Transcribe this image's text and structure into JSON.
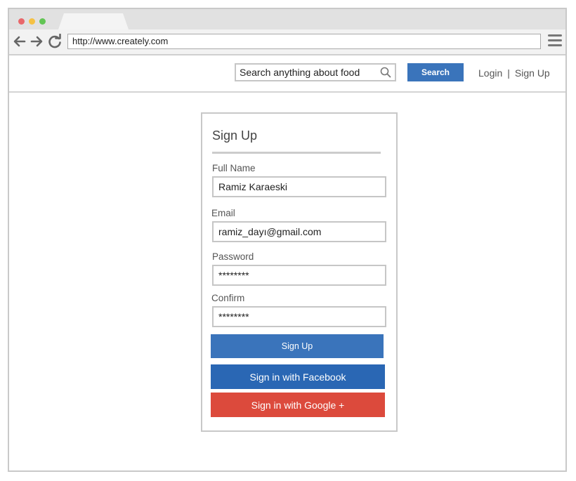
{
  "browser": {
    "url": "http://www.creately.com"
  },
  "header": {
    "search_placeholder": "Search anything about food",
    "search_button": "Search",
    "login_link": "Login",
    "separator": "|",
    "signup_link": "Sign Up"
  },
  "form": {
    "title": "Sign Up",
    "fields": [
      {
        "label": "Full Name",
        "value": "Ramiz Karaeski"
      },
      {
        "label": "Email",
        "value": "ramiz_dayı@gmail.com"
      },
      {
        "label": "Password",
        "value": "********"
      },
      {
        "label": "Confirm",
        "value": "********"
      }
    ],
    "signup_button": "Sign Up",
    "facebook_button": "Sign in with Facebook",
    "google_button": "Sign in with Google +"
  },
  "colors": {
    "primary_blue": "#3a74bb",
    "facebook_blue": "#2a67b4",
    "google_red": "#dc4a3c"
  }
}
